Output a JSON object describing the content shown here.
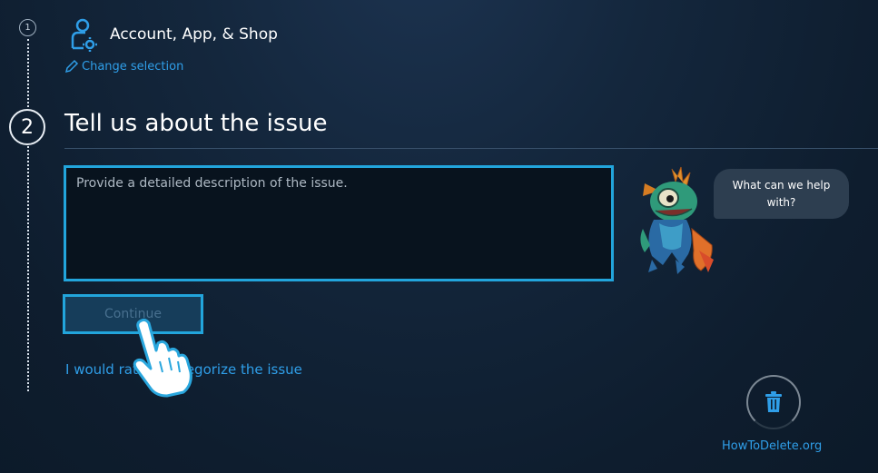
{
  "steps": {
    "step1_number": "1",
    "step2_number": "2"
  },
  "category": {
    "title": "Account, App, & Shop",
    "icon": "user-gear-icon",
    "change_label": "Change selection"
  },
  "issue": {
    "heading": "Tell us about the issue",
    "description_placeholder": "Provide a detailed description of the issue.",
    "description_value": "",
    "continue_label": "Continue",
    "categorize_link": "I would rather categorize the issue"
  },
  "assistant": {
    "bubble_text": "What can we help with?"
  },
  "watermark": {
    "text": "HowToDelete.org",
    "icon": "trash-icon"
  },
  "colors": {
    "accent": "#22a5dc",
    "link": "#2f9ee8",
    "background": "#0e1d2e"
  }
}
